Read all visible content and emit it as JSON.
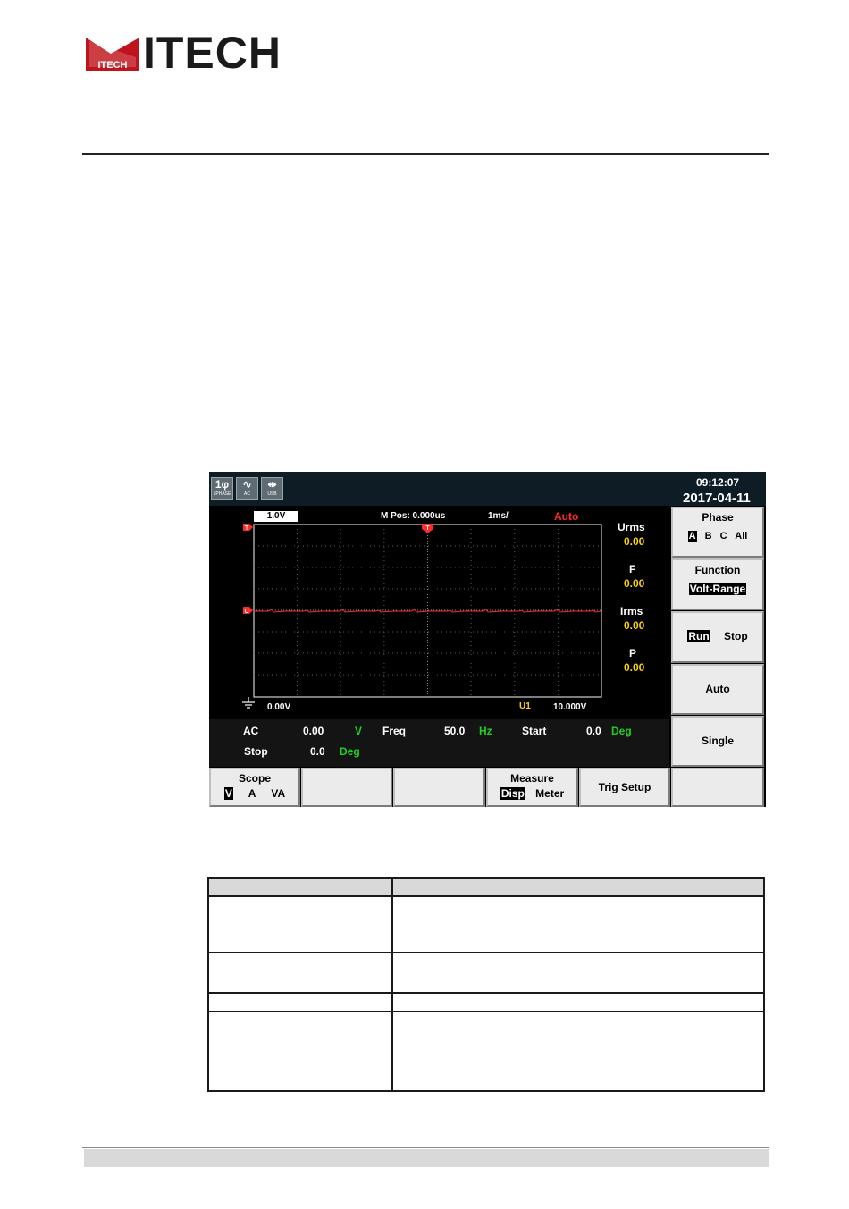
{
  "header": {
    "logo_text": "ITECH",
    "logo_mark": "ITECH"
  },
  "status_bar": {
    "indicators": [
      {
        "icon": "single-phase-icon",
        "top": "1φ",
        "bottom": "1PHASE"
      },
      {
        "icon": "ac-waveform-icon",
        "top": "∿",
        "bottom": "AC"
      },
      {
        "icon": "usb-icon",
        "top": "⇹",
        "bottom": "USB"
      }
    ],
    "time": "09:12:07",
    "date": "2017-04-11"
  },
  "scope": {
    "scale": "1.0V",
    "m_pos": "M Pos: 0.000us",
    "timebase": "1ms/",
    "trigger_mode": "Auto",
    "ground_label": "0.00V",
    "channel_label": "U1",
    "trigger_level": "10.000V",
    "trace_color": "#ff2a2a"
  },
  "readings": [
    {
      "label": "Urms",
      "value": "0.00"
    },
    {
      "label": "F",
      "value": "0.00"
    },
    {
      "label": "Irms",
      "value": "0.00"
    },
    {
      "label": "P",
      "value": "0.00"
    }
  ],
  "info": {
    "ac_label": "AC",
    "ac_value": "0.00",
    "ac_unit": "V",
    "freq_label": "Freq",
    "freq_value": "50.0",
    "freq_unit": "Hz",
    "start_label": "Start",
    "start_value": "0.0",
    "start_unit": "Deg",
    "stop_label": "Stop",
    "stop_value": "0.0",
    "stop_unit": "Deg"
  },
  "side_softkeys": {
    "phase": {
      "title": "Phase",
      "options": [
        "A",
        "B",
        "C",
        "All"
      ],
      "selected": "A"
    },
    "function": {
      "title": "Function",
      "value": "Volt-Range"
    },
    "runstop": {
      "run": "Run",
      "stop": "Stop",
      "selected": "Run"
    },
    "auto": "Auto",
    "single": "Single"
  },
  "bottom_softkeys": {
    "scope": {
      "title": "Scope",
      "options": [
        "V",
        "A",
        "VA"
      ],
      "selected": "V"
    },
    "measure": {
      "title": "Measure",
      "options": [
        "Disp",
        "Meter"
      ],
      "selected": "Disp"
    },
    "trig_setup": "Trig Setup"
  },
  "colors": {
    "accent_red": "#c0141c",
    "value_yellow": "#ffd400",
    "unit_green": "#20d020"
  }
}
